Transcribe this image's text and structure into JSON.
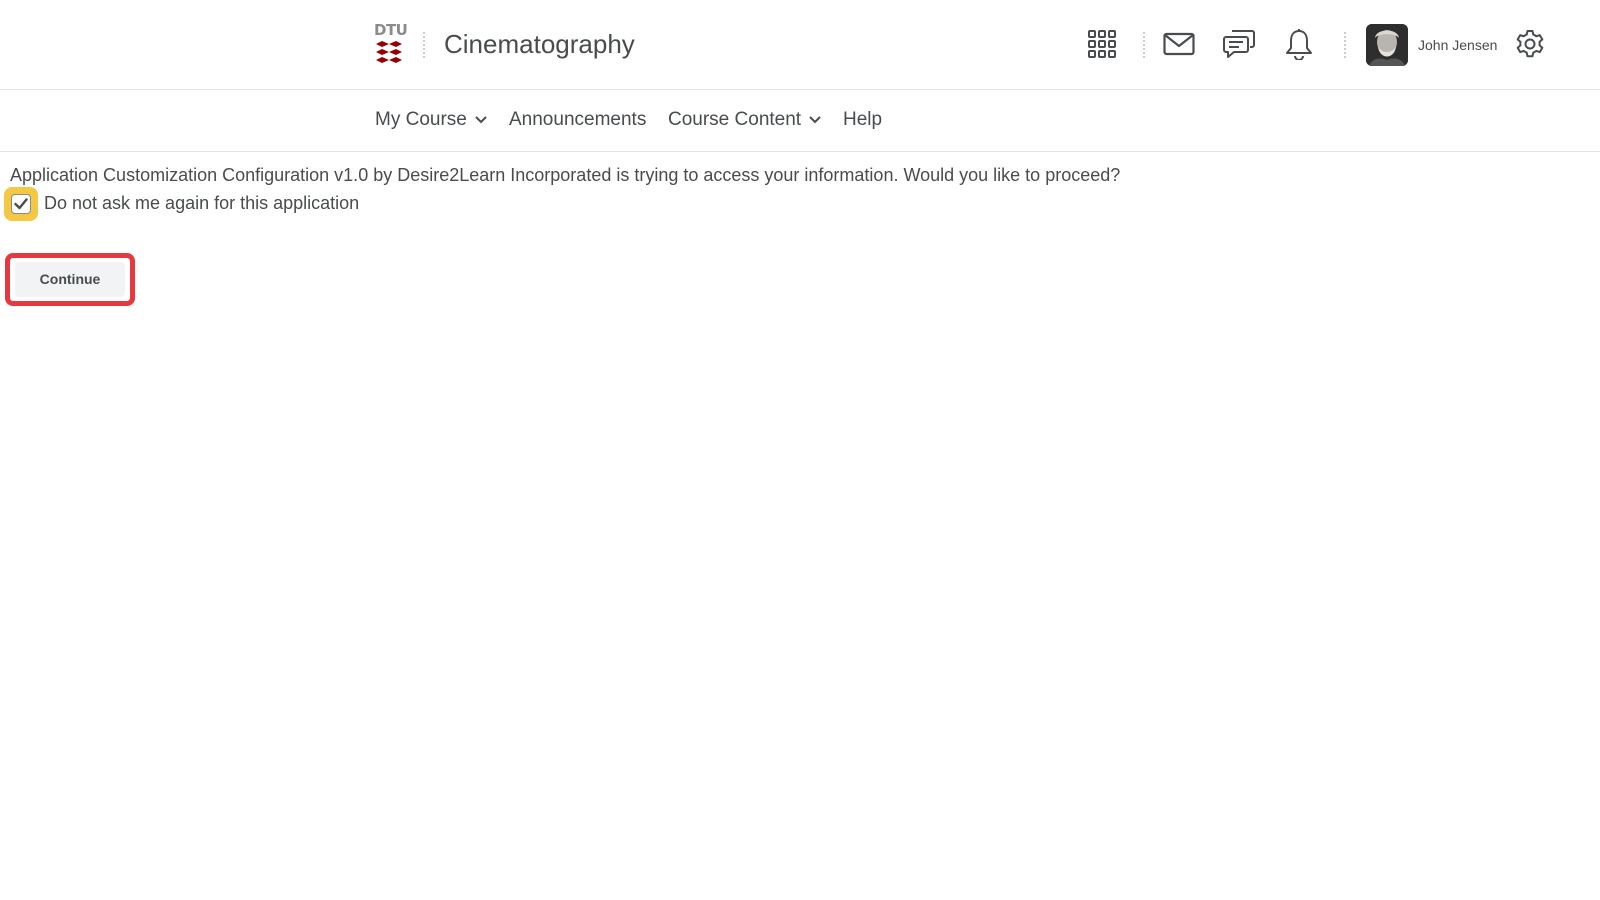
{
  "header": {
    "logo_text": "DTU",
    "course_title": "Cinematography",
    "icons": [
      "apps-grid-icon",
      "mail-icon",
      "chat-icon",
      "bell-icon",
      "gear-icon"
    ],
    "user_name": "John Jensen"
  },
  "nav": {
    "items": [
      {
        "label": "My Course",
        "dropdown": true
      },
      {
        "label": "Announcements",
        "dropdown": false
      },
      {
        "label": "Course Content",
        "dropdown": true
      },
      {
        "label": "Help",
        "dropdown": false
      }
    ]
  },
  "main": {
    "prompt": "Application Customization Configuration v1.0 by Desire2Learn Incorporated is trying to access your information. Would you like to proceed?",
    "checkbox_label": "Do not ask me again for this application",
    "checkbox_checked": true,
    "continue_label": "Continue"
  },
  "colors": {
    "text": "#494c4e",
    "logo_red": "#990000",
    "checkbox_highlight": "#f5c844",
    "button_highlight_border": "#e5383f"
  }
}
